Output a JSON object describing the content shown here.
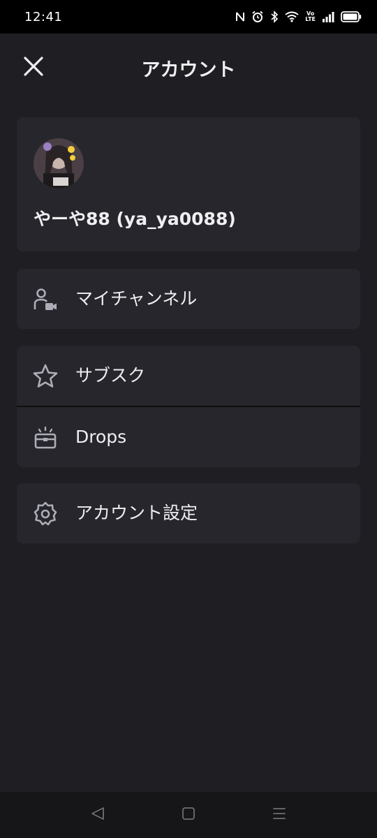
{
  "status_bar": {
    "time": "12:41",
    "icons": [
      "nfc-icon",
      "alarm-icon",
      "bluetooth-icon",
      "wifi-icon",
      "volte-icon",
      "signal-icon",
      "battery-icon"
    ],
    "volte_top": "Vo",
    "volte_bottom": "LTE"
  },
  "header": {
    "title": "アカウント",
    "close_icon": "close-icon"
  },
  "profile": {
    "display_name": "やーや88 (ya_ya0088)",
    "avatar_icon": "avatar"
  },
  "menu": {
    "channel": {
      "label": "マイチャンネル",
      "icon": "user-camera-icon"
    },
    "subscriptions": {
      "label": "サブスク",
      "icon": "star-icon"
    },
    "drops": {
      "label": "Drops",
      "icon": "drops-chest-icon"
    },
    "settings": {
      "label": "アカウント設定",
      "icon": "gear-icon"
    }
  },
  "nav_bar": {
    "back": "back-triangle-icon",
    "home": "home-square-icon",
    "recents": "recents-menu-icon"
  },
  "colors": {
    "background": "#1f1f23",
    "card": "#26262c",
    "text": "#efeff1",
    "icon": "#adadb8",
    "status_bar": "#000000",
    "nav_bar": "#161618"
  }
}
